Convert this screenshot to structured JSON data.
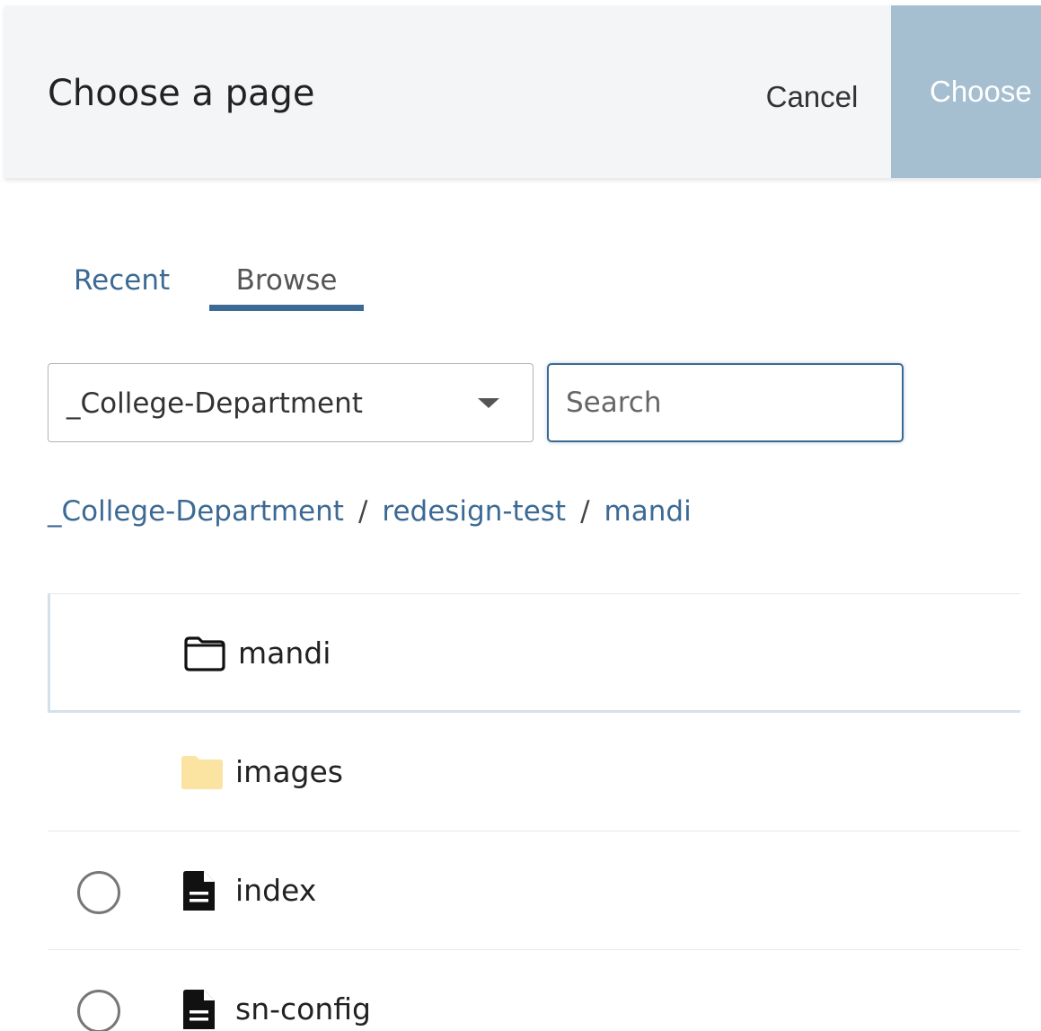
{
  "header": {
    "title": "Choose a page",
    "cancel_label": "Cancel",
    "choose_label": "Choose"
  },
  "tabs": [
    {
      "label": "Recent",
      "active": false
    },
    {
      "label": "Browse",
      "active": true
    }
  ],
  "site_select": {
    "value": "_College-Department"
  },
  "search": {
    "placeholder": "Search",
    "value": ""
  },
  "breadcrumb": [
    {
      "label": "_College-Department"
    },
    {
      "label": "redesign-test"
    },
    {
      "label": "mandi"
    }
  ],
  "breadcrumb_separator": "/",
  "items": [
    {
      "label": "mandi",
      "icon": "folder-outline-icon",
      "selectable": false
    },
    {
      "label": "images",
      "icon": "folder-icon",
      "selectable": false
    },
    {
      "label": "index",
      "icon": "file-icon",
      "selectable": true
    },
    {
      "label": "sn-config",
      "icon": "file-icon",
      "selectable": true
    }
  ],
  "colors": {
    "accent": "#3c6a94",
    "choose_button": "#a5bfd1",
    "folder_yellow": "#fbe3a2",
    "header_bg": "#f4f5f7"
  }
}
